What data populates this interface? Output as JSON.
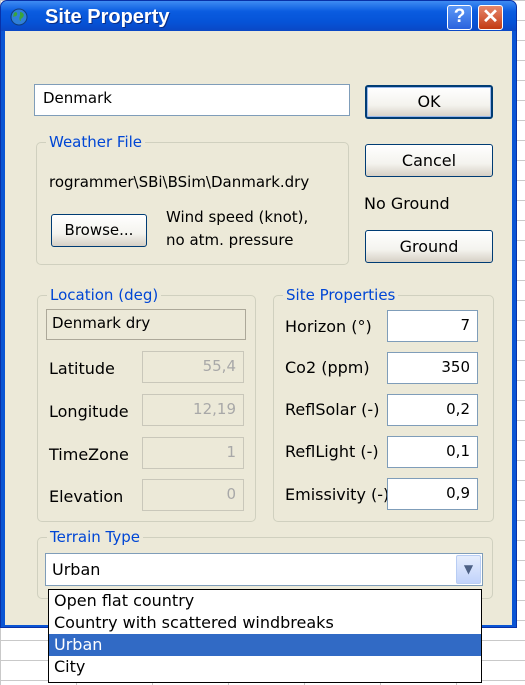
{
  "window": {
    "title": "Site Property",
    "help_label": "?",
    "close_label": "✕",
    "icon": "earth-globe-icon"
  },
  "site_name": {
    "value": "Denmark"
  },
  "buttons": {
    "ok": "OK",
    "cancel": "Cancel",
    "ground": "Ground",
    "browse": "Browse..."
  },
  "ground_status": "No Ground",
  "weather_file": {
    "legend": "Weather File",
    "path": "rogrammer\\SBi\\BSim\\Danmark.dry",
    "info_line1": "Wind speed (knot),",
    "info_line2": "no atm. pressure"
  },
  "location": {
    "legend": "Location (deg)",
    "name": "Denmark dry",
    "fields": [
      {
        "label": "Latitude",
        "value": "55,4"
      },
      {
        "label": "Longitude",
        "value": "12,19"
      },
      {
        "label": "TimeZone",
        "value": "1"
      },
      {
        "label": "Elevation",
        "value": "0"
      }
    ]
  },
  "site_properties": {
    "legend": "Site Properties",
    "fields": [
      {
        "label": "Horizon (°)",
        "value": "7"
      },
      {
        "label": "Co2 (ppm)",
        "value": "350"
      },
      {
        "label": "ReflSolar (-)",
        "value": "0,2"
      },
      {
        "label": "ReflLight (-)",
        "value": "0,1"
      },
      {
        "label": "Emissivity (-)",
        "value": "0,9"
      }
    ]
  },
  "terrain": {
    "legend": "Terrain Type",
    "selected": "Urban",
    "options": [
      "Open flat country",
      "Country with scattered windbreaks",
      "Urban",
      "City"
    ]
  },
  "colors": {
    "title_bar": "#0a55d4",
    "dialog_bg": "#ece9d8",
    "legend_text": "#0046d5",
    "selection": "#316ac5"
  }
}
